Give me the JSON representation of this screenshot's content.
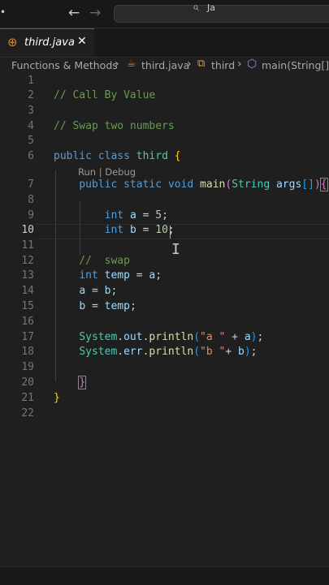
{
  "titlebar": {
    "menu_glyph": "•",
    "back_icon": "←",
    "forward_icon": "→",
    "search_icon": "⌕",
    "search_text": "Ja"
  },
  "tab": {
    "icon": "⊕",
    "label": "third.java",
    "close": "✕"
  },
  "breadcrumb": {
    "items": [
      "Functions & Methods",
      "third.java",
      "third",
      "main(String[])"
    ],
    "separator": "›",
    "icons": {
      "file": "☕",
      "class": "⧉",
      "method": "⬡"
    }
  },
  "editor": {
    "active_line": 10,
    "codelens": "Run | Debug",
    "line_numbers": [
      "1",
      "2",
      "3",
      "4",
      "5",
      "6",
      "7",
      "8",
      "9",
      "10",
      "11",
      "12",
      "13",
      "14",
      "15",
      "16",
      "17",
      "18",
      "19",
      "20",
      "21",
      "22"
    ],
    "lines": [
      [],
      [
        {
          "t": "// Call By Value",
          "c": "cm"
        }
      ],
      [],
      [
        {
          "t": "// Swap two numbers",
          "c": "cm"
        }
      ],
      [],
      [
        {
          "t": "public",
          "c": "kw"
        },
        {
          "t": " ",
          "c": "pu"
        },
        {
          "t": "class",
          "c": "kw"
        },
        {
          "t": " ",
          "c": "pu"
        },
        {
          "t": "third",
          "c": "ty"
        },
        {
          "t": " ",
          "c": "pu"
        },
        {
          "t": "{",
          "c": "br1"
        }
      ],
      [
        {
          "t": "    ",
          "c": "pu"
        },
        {
          "t": "public",
          "c": "kw"
        },
        {
          "t": " ",
          "c": "pu"
        },
        {
          "t": "static",
          "c": "kw"
        },
        {
          "t": " ",
          "c": "pu"
        },
        {
          "t": "void",
          "c": "kw"
        },
        {
          "t": " ",
          "c": "pu"
        },
        {
          "t": "main",
          "c": "fn"
        },
        {
          "t": "(",
          "c": "br2"
        },
        {
          "t": "String",
          "c": "ty"
        },
        {
          "t": " ",
          "c": "pu"
        },
        {
          "t": "args",
          "c": "va"
        },
        {
          "t": "[]",
          "c": "br3"
        },
        {
          "t": ")",
          "c": "br2"
        },
        {
          "t": "{",
          "c": "br2 bracket-box"
        }
      ],
      [],
      [
        {
          "t": "        ",
          "c": "pu"
        },
        {
          "t": "int",
          "c": "kw"
        },
        {
          "t": " ",
          "c": "pu"
        },
        {
          "t": "a",
          "c": "va"
        },
        {
          "t": " = ",
          "c": "pu"
        },
        {
          "t": "5",
          "c": "nu"
        },
        {
          "t": ";",
          "c": "pu"
        }
      ],
      [
        {
          "t": "        ",
          "c": "pu"
        },
        {
          "t": "int",
          "c": "kw"
        },
        {
          "t": " ",
          "c": "pu"
        },
        {
          "t": "b",
          "c": "va"
        },
        {
          "t": " = ",
          "c": "pu"
        },
        {
          "t": "10",
          "c": "nu"
        },
        {
          "t": ";",
          "c": "pu"
        }
      ],
      [],
      [
        {
          "t": "    //  swap",
          "c": "cm"
        }
      ],
      [
        {
          "t": "    ",
          "c": "pu"
        },
        {
          "t": "int",
          "c": "kw"
        },
        {
          "t": " ",
          "c": "pu"
        },
        {
          "t": "temp",
          "c": "va"
        },
        {
          "t": " = ",
          "c": "pu"
        },
        {
          "t": "a",
          "c": "va"
        },
        {
          "t": ";",
          "c": "pu"
        }
      ],
      [
        {
          "t": "    ",
          "c": "pu"
        },
        {
          "t": "a",
          "c": "va"
        },
        {
          "t": " = ",
          "c": "pu"
        },
        {
          "t": "b",
          "c": "va"
        },
        {
          "t": ";",
          "c": "pu"
        }
      ],
      [
        {
          "t": "    ",
          "c": "pu"
        },
        {
          "t": "b",
          "c": "va"
        },
        {
          "t": " = ",
          "c": "pu"
        },
        {
          "t": "temp",
          "c": "va"
        },
        {
          "t": ";",
          "c": "pu"
        }
      ],
      [],
      [
        {
          "t": "    ",
          "c": "pu"
        },
        {
          "t": "System",
          "c": "ty"
        },
        {
          "t": ".",
          "c": "pu"
        },
        {
          "t": "out",
          "c": "va"
        },
        {
          "t": ".",
          "c": "pu"
        },
        {
          "t": "println",
          "c": "fn"
        },
        {
          "t": "(",
          "c": "br3"
        },
        {
          "t": "\"a \"",
          "c": "st"
        },
        {
          "t": " + ",
          "c": "pu"
        },
        {
          "t": "a",
          "c": "va"
        },
        {
          "t": ")",
          "c": "br3"
        },
        {
          "t": ";",
          "c": "pu"
        }
      ],
      [
        {
          "t": "    ",
          "c": "pu"
        },
        {
          "t": "System",
          "c": "ty"
        },
        {
          "t": ".",
          "c": "pu"
        },
        {
          "t": "err",
          "c": "va"
        },
        {
          "t": ".",
          "c": "pu"
        },
        {
          "t": "println",
          "c": "fn"
        },
        {
          "t": "(",
          "c": "br3"
        },
        {
          "t": "\"b \"",
          "c": "st"
        },
        {
          "t": "+ ",
          "c": "pu"
        },
        {
          "t": "b",
          "c": "va"
        },
        {
          "t": ")",
          "c": "br3"
        },
        {
          "t": ";",
          "c": "pu"
        }
      ],
      [],
      [
        {
          "t": "    ",
          "c": "pu"
        },
        {
          "t": "}",
          "c": "br2 bracket-box"
        }
      ],
      [
        {
          "t": "}",
          "c": "br1"
        }
      ],
      []
    ]
  },
  "colors": {
    "background": "#1f1f1f",
    "comment": "#6a9955",
    "keyword": "#569cd6",
    "type": "#4ec9b0",
    "function": "#dcdcaa",
    "variable": "#9cdcfe",
    "number": "#b5cea8",
    "string": "#ce9178"
  }
}
